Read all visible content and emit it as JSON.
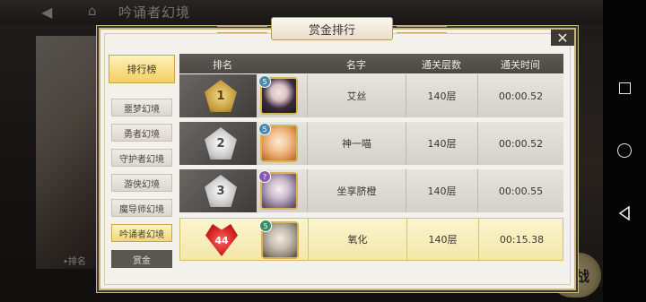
{
  "background": {
    "title": "吟诵者幻境",
    "rank_text": "•排名",
    "fight_label": "挑战"
  },
  "dialog": {
    "title": "赏金排行",
    "close_label": "✕"
  },
  "tabs": {
    "main": "排行榜",
    "items": [
      {
        "label": "噩梦幻境",
        "active": false
      },
      {
        "label": "勇者幻境",
        "active": false
      },
      {
        "label": "守护者幻境",
        "active": false
      },
      {
        "label": "游侠幻境",
        "active": false
      },
      {
        "label": "魔导师幻境",
        "active": false
      },
      {
        "label": "吟诵者幻境",
        "active": true
      }
    ],
    "more": "赏金"
  },
  "table": {
    "headers": [
      "排名",
      "名字",
      "通关层数",
      "通关时间"
    ],
    "rows": [
      {
        "rank": "1",
        "name": "艾丝",
        "floor": "140层",
        "time": "00:00.52",
        "badge": "gold",
        "avatar_mark": "5"
      },
      {
        "rank": "2",
        "name": "神一喵",
        "floor": "140层",
        "time": "00:00.52",
        "badge": "silver",
        "avatar_mark": "5"
      },
      {
        "rank": "3",
        "name": "坐享脐橙",
        "floor": "140层",
        "time": "00:00.55",
        "badge": "silver",
        "avatar_mark": "?"
      },
      {
        "rank": "44",
        "name": "氧化",
        "floor": "140层",
        "time": "00:15.38",
        "badge": "red",
        "avatar_mark": "5",
        "is_self": true
      }
    ]
  },
  "nav": {
    "icons": [
      "recents-icon",
      "home-icon",
      "back-icon"
    ]
  },
  "colors": {
    "gold_accent": "#d9b552",
    "highlight_row": "#f4e7a8",
    "header_bg": "#4c4945"
  }
}
